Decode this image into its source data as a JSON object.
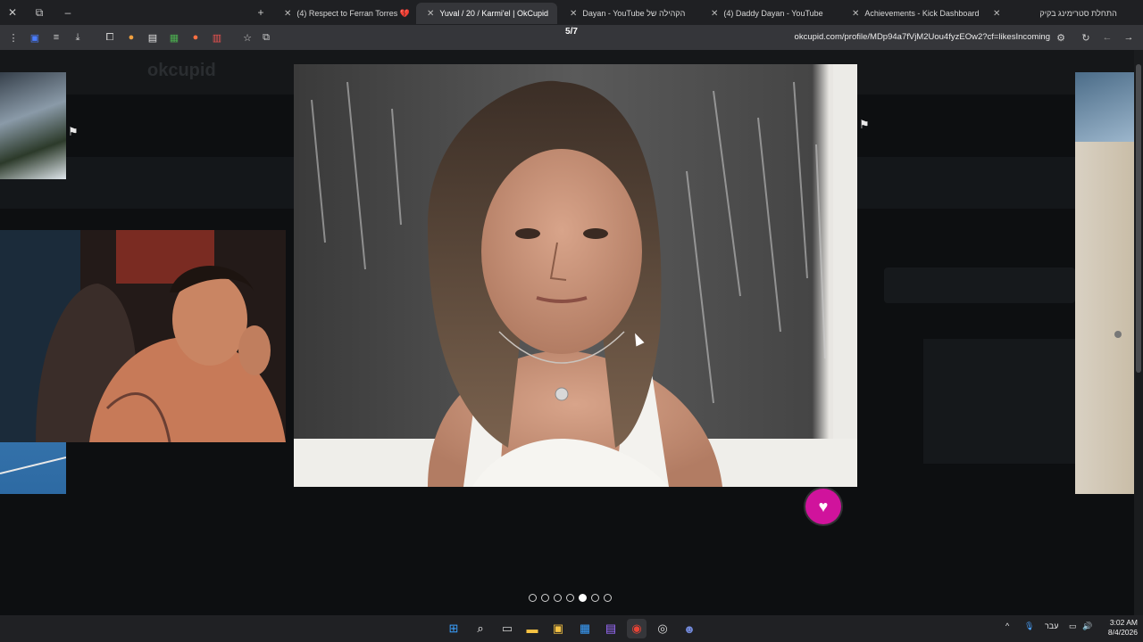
{
  "tabs": [
    {
      "label": "(4) Respect to Ferran Torres 💔",
      "favicon_color": "#ff0000"
    },
    {
      "label": "Yuval / 20 / Karmi'el | OkCupid",
      "favicon_color": "#d0139c",
      "active": true
    },
    {
      "label": "Dayan - YouTube הקהילה של",
      "favicon_color": "#ff0000"
    },
    {
      "label": "(4) Daddy Dayan - YouTube",
      "favicon_color": "#ff0000"
    },
    {
      "label": "Achievements - Kick Dashboard",
      "favicon_color": "#53fc18"
    },
    {
      "label": "התחלת סטרימינג בקיק",
      "favicon_color": "#cccccc"
    }
  ],
  "address_bar": {
    "url": "okcupid.com/profile/MDp94a7fVjM2Uou4fyzEOw2?cf=likesIncoming"
  },
  "gallery": {
    "counter": "5/7",
    "total_photos": 7,
    "active_index": 4,
    "like_button_icon": "heart-icon"
  },
  "background": {
    "logo": "okcupid"
  },
  "system": {
    "time": "3:02 AM",
    "date": "8/4/2026",
    "language": "עבר"
  },
  "colors": {
    "accent": "#d0139c",
    "tab_bar": "#1f2023",
    "toolbar": "#35363a"
  }
}
